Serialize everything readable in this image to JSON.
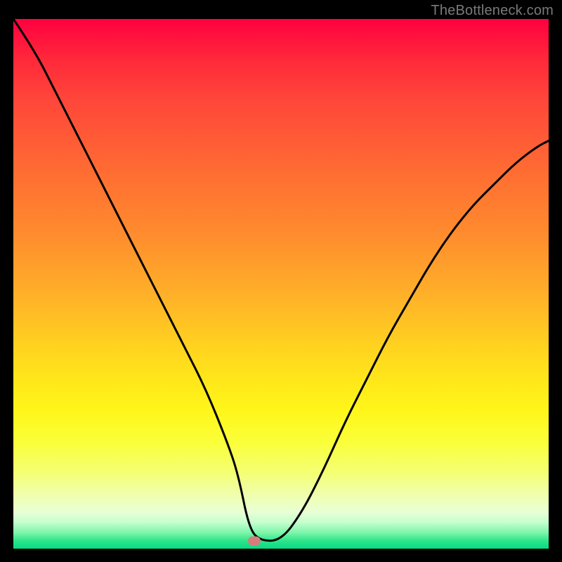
{
  "watermark": "TheBottleneck.com",
  "colors": {
    "background": "#000000",
    "curve": "#000000",
    "marker": "#d47d7a",
    "gradient_top": "#ff0040",
    "gradient_bottom": "#06da84"
  },
  "chart_data": {
    "type": "line",
    "title": "",
    "xlabel": "",
    "ylabel": "",
    "xlim": [
      0,
      100
    ],
    "ylim": [
      0,
      100
    ],
    "annotations": [
      {
        "name": "optimal-marker",
        "x": 45,
        "y": 1.5
      }
    ],
    "series": [
      {
        "name": "bottleneck-curve",
        "x": [
          0,
          4,
          8,
          12,
          16,
          20,
          24,
          28,
          32,
          36,
          40,
          42,
          44,
          46,
          50,
          54,
          58,
          62,
          66,
          70,
          74,
          78,
          82,
          86,
          90,
          94,
          98,
          100
        ],
        "values": [
          100,
          94,
          86,
          78,
          70,
          62,
          54,
          46,
          38,
          30,
          20,
          14,
          4,
          1.5,
          1.5,
          7,
          15,
          24,
          32,
          40,
          47,
          54,
          60,
          65,
          69,
          73,
          76,
          77
        ]
      }
    ]
  }
}
